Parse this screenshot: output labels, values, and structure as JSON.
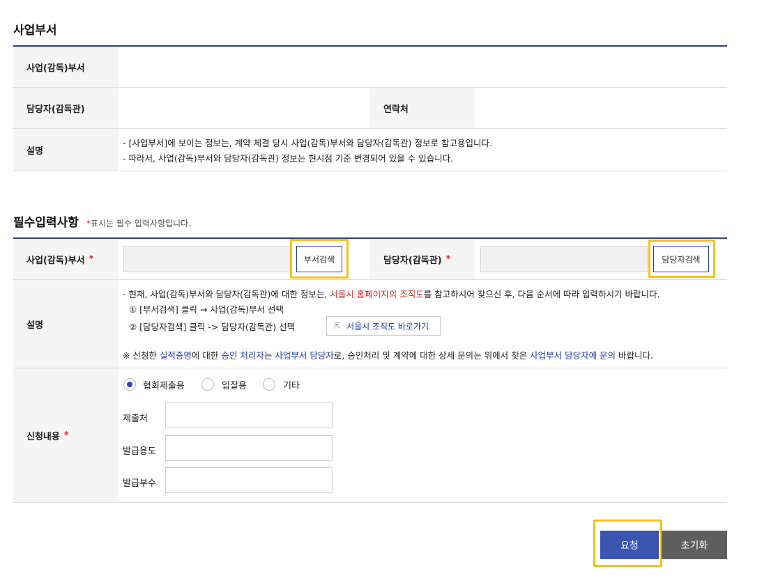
{
  "section1": {
    "title": "사업부서",
    "rows": {
      "dept_label": "사업(감독)부서",
      "manager_label": "담당자(감독관)",
      "contact_label": "연락처",
      "desc_label": "설명",
      "desc_line1": "- [사업부서]에 보이는 정보는, 계약 체결 당시 사업(감독)부서와 담당자(감독관) 정보로 참고용입니다.",
      "desc_line2": "- 따라서, 사업(감독)부서와 담당자(감독관) 정보는 현시점 기준 변경되어 있을 수 있습니다."
    }
  },
  "section2": {
    "title": "필수입력사항",
    "note_star": "*",
    "note_text": "표시는 필수 입력사항입니다.",
    "dept_label": "사업(감독)부서",
    "required_mark": "*",
    "dept_search_button": "부서검색",
    "manager_label": "담당자(감독관)",
    "manager_search_button": "담당자검색",
    "desc_label": "설명",
    "desc_line1_a": "- 현재, 사업(감독)부서와 담당자(감독관)에 대한 정보는, ",
    "desc_line1_link": "서울시 홈페이지의 조직도",
    "desc_line1_b": "를 참고하시어 찾으신 후, 다음 순서에 따라 입력하시기 바랍니다.",
    "step1": "① [부서검색] 클릭 → 사업(감독)부서 선택",
    "step2": "② [담당자검색] 클릭 -> 담당자(감독관) 선택",
    "org_chart_button": "서울시 조직도 바로가기",
    "notice_p1": "※ 신청한 ",
    "notice_p2": "실적증명",
    "notice_p3": "에 대한 ",
    "notice_p4": "승인 처리자",
    "notice_p5": "는 ",
    "notice_p6": "사업부서 담당자",
    "notice_p7": "로, 승인처리 및 계약에 대한 상세 문의는 위에서 찾은 ",
    "notice_p8": "사업부서 담당자에 문의",
    "notice_p9": " 바랍니다.",
    "request_label": "신청내용",
    "radios": [
      {
        "label": "협회제출용",
        "checked": true
      },
      {
        "label": "입찰용",
        "checked": false
      },
      {
        "label": "기타",
        "checked": false
      }
    ],
    "fields": {
      "submit_to": "제출처",
      "purpose": "발급용도",
      "copies": "발급부수"
    }
  },
  "actions": {
    "request_button": "요청",
    "reset_button": "초기화"
  },
  "colors": {
    "primary": "#3b54b0",
    "highlight": "#f6c21a",
    "reset_bg": "#5f5f5f",
    "required": "#d12a2a"
  }
}
